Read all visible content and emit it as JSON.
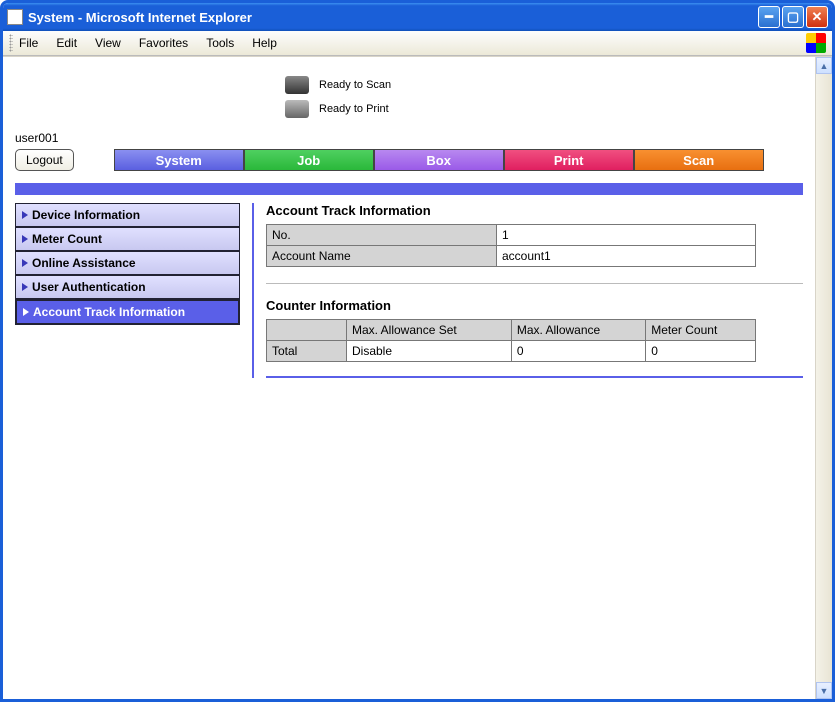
{
  "window": {
    "title": "System - Microsoft Internet Explorer"
  },
  "menubar": {
    "file": "File",
    "edit": "Edit",
    "view": "View",
    "favorites": "Favorites",
    "tools": "Tools",
    "help": "Help"
  },
  "ready": {
    "scan": "Ready to Scan",
    "print": "Ready to Print"
  },
  "user": "user001",
  "logout_label": "Logout",
  "tabs": {
    "system": "System",
    "job": "Job",
    "box": "Box",
    "print": "Print",
    "scan": "Scan"
  },
  "sidebar": {
    "items": [
      {
        "label": "Device Information"
      },
      {
        "label": "Meter Count"
      },
      {
        "label": "Online Assistance"
      },
      {
        "label": "User Authentication"
      },
      {
        "label": "Account Track Information"
      }
    ]
  },
  "account_info": {
    "title": "Account Track Information",
    "no_label": "No.",
    "no_value": "1",
    "name_label": "Account Name",
    "name_value": "account1"
  },
  "counter_info": {
    "title": "Counter Information",
    "col_allow_set": "Max. Allowance Set",
    "col_allow": "Max. Allowance",
    "col_meter": "Meter Count",
    "row_total_label": "Total",
    "row_total_allow_set": "Disable",
    "row_total_allow": "0",
    "row_total_meter": "0"
  }
}
